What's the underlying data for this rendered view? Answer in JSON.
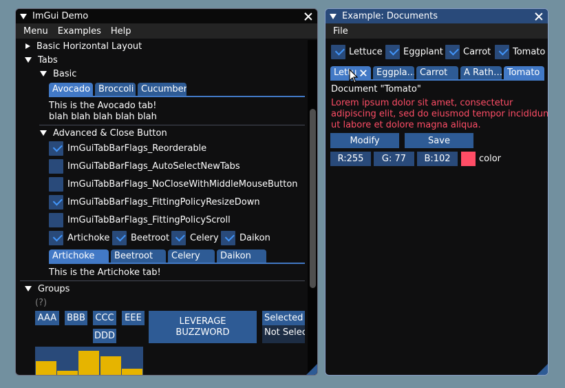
{
  "left_window": {
    "title": "ImGui Demo",
    "menu": [
      "Menu",
      "Examples",
      "Help"
    ],
    "basic_horizontal_layout": "Basic Horizontal Layout",
    "tabs_header": "Tabs",
    "basic_header": "Basic",
    "basic_tabs": [
      "Avocado",
      "Broccoli",
      "Cucumber"
    ],
    "avocado_text_1": "This is the Avocado tab!",
    "avocado_text_2": "blah blah blah blah blah",
    "advanced_header": "Advanced & Close Button",
    "flags": [
      {
        "label": "ImGuiTabBarFlags_Reorderable",
        "checked": true
      },
      {
        "label": "ImGuiTabBarFlags_AutoSelectNewTabs",
        "checked": false
      },
      {
        "label": "ImGuiTabBarFlags_NoCloseWithMiddleMouseButton",
        "checked": false
      },
      {
        "label": "ImGuiTabBarFlags_FittingPolicyResizeDown",
        "checked": true
      },
      {
        "label": "ImGuiTabBarFlags_FittingPolicyScroll",
        "checked": false
      }
    ],
    "veg_checks": [
      "Artichoke",
      "Beetroot",
      "Celery",
      "Daikon"
    ],
    "veg_tabs": [
      "Artichoke",
      "Beetroot",
      "Celery",
      "Daikon"
    ],
    "artichoke_text": "This is the Artichoke tab!",
    "groups_header": "Groups",
    "help_marker": "(?)",
    "group_buttons": [
      "AAA",
      "BBB",
      "CCC",
      "EEE",
      "DDD"
    ],
    "leverage_line1": "LEVERAGE",
    "leverage_line2": "BUZZWORD",
    "selectable_1": "Selected",
    "selectable_2": "Not Selec",
    "histogram_values": [
      0.55,
      0.15,
      0.95,
      0.72,
      0.25
    ]
  },
  "right_window": {
    "title": "Example: Documents",
    "menu": [
      "File"
    ],
    "doc_checks": [
      "Lettuce",
      "Eggplant",
      "Carrot",
      "Tomato"
    ],
    "doc_tabs": [
      "Lettu",
      "Eggpla…",
      "Carrot",
      "A Rath…",
      "Tomato"
    ],
    "doc_title": "Document \"Tomato\"",
    "lorem_1": "Lorem ipsum dolor sit amet, consectetur",
    "lorem_2": "adipiscing elit, sed do eiusmod tempor incididunt",
    "lorem_3": "ut labore et dolore magna aliqua.",
    "modify_label": "Modify",
    "save_label": "Save",
    "r_field": "R:255",
    "g_field": "G: 77",
    "b_field": "B:102",
    "color_label": "color",
    "swatch_color": "#ff4d66",
    "lorem_color": "#ff4d66"
  }
}
